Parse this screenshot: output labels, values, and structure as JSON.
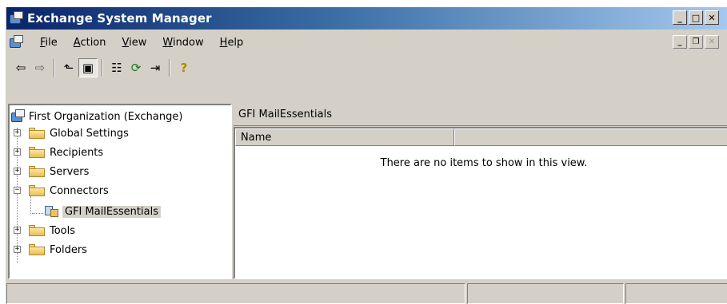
{
  "window": {
    "title": "Exchange System Manager"
  },
  "title_buttons": {
    "minimize": "_",
    "maximize": "□",
    "close": "✕"
  },
  "menubar": {
    "items": [
      {
        "label": "File",
        "accel": "F"
      },
      {
        "label": "Action",
        "accel": "A"
      },
      {
        "label": "View",
        "accel": "V"
      },
      {
        "label": "Window",
        "accel": "W"
      },
      {
        "label": "Help",
        "accel": "H"
      }
    ]
  },
  "toolbar": {
    "back": "⇦",
    "forward": "⇨",
    "up": "⬑",
    "show_tree": "▣",
    "properties": "☷",
    "refresh": "⟳",
    "export": "⇥",
    "help": "?"
  },
  "tree": {
    "root": "First Organization (Exchange)",
    "items": [
      {
        "label": "Global Settings",
        "expander": "+"
      },
      {
        "label": "Recipients",
        "expander": "+"
      },
      {
        "label": "Servers",
        "expander": "+"
      },
      {
        "label": "Connectors",
        "expander": "−"
      },
      {
        "label": "GFI MailEssentials"
      },
      {
        "label": "Tools",
        "expander": "+"
      },
      {
        "label": "Folders",
        "expander": "+"
      }
    ]
  },
  "right_pane": {
    "title": "GFI MailEssentials",
    "columns": [
      "Name",
      ""
    ],
    "empty_message": "There are no items to show in this view."
  }
}
